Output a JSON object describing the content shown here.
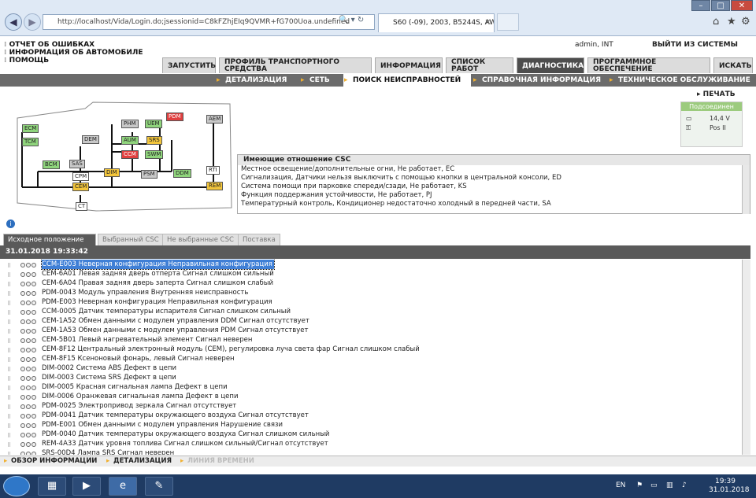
{
  "browser": {
    "url": "http://localhost/Vida/Login.do;jsessionid=C8kFZhjEIq9QVMR+fG700Uoa.undefined",
    "tab_title": "S60 (-09), 2003, B5244S, AW...",
    "window_controls": [
      "–",
      "□",
      "✕"
    ]
  },
  "header": {
    "links": [
      "ОТЧЕТ ОБ ОШИБКАХ",
      "ИНФОРМАЦИЯ ОБ АВТОМОБИЛЕ",
      "ПОМОЩЬ"
    ],
    "user": "admin, INT",
    "logout": "ВЫЙТИ ИЗ СИСТЕМЫ"
  },
  "main_tabs": [
    {
      "label": "ЗАПУСТИТЬ"
    },
    {
      "label": "ПРОФИЛЬ ТРАНСПОРТНОГО СРЕДСТВА"
    },
    {
      "label": "ИНФОРМАЦИЯ"
    },
    {
      "label": "СПИСОК РАБОТ"
    },
    {
      "label": "ДИАГНОСТИКА",
      "active": true
    },
    {
      "label": "ПРОГРАММНОЕ ОБЕСПЕЧЕНИЕ"
    },
    {
      "label": "ИСКАТЬ"
    }
  ],
  "sub_tabs": [
    {
      "label": "ДЕТАЛИЗАЦИЯ"
    },
    {
      "label": "СЕТЬ"
    },
    {
      "label": "ПОИСК НЕИСПРАВНОСТЕЙ",
      "active": true
    },
    {
      "label": "СПРАВОЧНАЯ ИНФОРМАЦИЯ"
    },
    {
      "label": "ТЕХНИЧЕСКОЕ ОБСЛУЖИВАНИЕ"
    }
  ],
  "print_label": "ПЕЧАТЬ",
  "status": {
    "title": "Подсоединен",
    "voltage": "14,4 V",
    "key_position": "Pos II"
  },
  "network_nodes": [
    {
      "name": "ECM",
      "state": "green"
    },
    {
      "name": "TCM",
      "state": "green"
    },
    {
      "name": "DEM",
      "state": "grey"
    },
    {
      "name": "BCM",
      "state": "green"
    },
    {
      "name": "SAS",
      "state": "grey"
    },
    {
      "name": "CPM",
      "state": "white"
    },
    {
      "name": "CEM",
      "state": "yellow"
    },
    {
      "name": "CT",
      "state": "white"
    },
    {
      "name": "PHM",
      "state": "grey"
    },
    {
      "name": "AUM",
      "state": "green"
    },
    {
      "name": "CCM",
      "state": "red"
    },
    {
      "name": "DIM",
      "state": "yellow"
    },
    {
      "name": "UEM",
      "state": "green"
    },
    {
      "name": "SRS",
      "state": "yellow"
    },
    {
      "name": "SWM",
      "state": "green"
    },
    {
      "name": "PSM",
      "state": "grey"
    },
    {
      "name": "PDM",
      "state": "red"
    },
    {
      "name": "DDM",
      "state": "green"
    },
    {
      "name": "AEM",
      "state": "grey"
    },
    {
      "name": "RTI",
      "state": "white"
    },
    {
      "name": "REM",
      "state": "yellow"
    }
  ],
  "csc": {
    "title": "Имеющие отношение CSC",
    "items": [
      "Местное освещение/дополнительные огни, Не работает, EC",
      "Сигнализация, Датчики нельзя выключить с помощью кнопки в центральной консоли, ED",
      "Система помощи при парковке спереди/сзади, Не работает, KS",
      "Функция поддержания устойчивости, Не работает, PJ",
      "Температурный контроль, Кондиционер недостаточно холодный в передней части, SA"
    ]
  },
  "fault_tabs": [
    {
      "label": "Исходное положение",
      "active": true
    },
    {
      "label": "Выбранный CSC"
    },
    {
      "label": "Не выбранные CSC"
    },
    {
      "label": "Поставка"
    }
  ],
  "datetime": "31.01.2018 19:33:42",
  "faults": [
    "CCM-E003 Неверная конфигурация Неправильная конфигурация",
    "CEM-6A01 Левая задняя дверь отперта Сигнал слишком сильный",
    "CEM-6A04 Правая задняя дверь заперта Сигнал слишком слабый",
    "PDM-0043 Модуль управления Внутренняя неисправность",
    "PDM-E003 Неверная конфигурация Неправильная конфигурация",
    "CCM-0005 Датчик температуры испарителя Сигнал слишком сильный",
    "CEM-1A52 Обмен данными с модулем управления DDM Сигнал отсутствует",
    "CEM-1A53 Обмен данными с модулем управления PDM Сигнал отсутствует",
    "CEM-5B01 Левый нагревательный элемент Сигнал неверен",
    "CEM-8F12 Центральный электронный модуль (CEM), регулировка луча света фар Сигнал слишком слабый",
    "CEM-8F15 Ксеноновый фонарь, левый Сигнал неверен",
    "DIM-0002 Система ABS Дефект в цепи",
    "DIM-0003 Система SRS Дефект в цепи",
    "DIM-0005 Красная сигнальная лампа Дефект в цепи",
    "DIM-0006 Оранжевая сигнальная лампа Дефект в цепи",
    "PDM-0025 Электропривод зеркала Сигнал отсутствует",
    "PDM-0041 Датчик температуры окружающего воздуха Сигнал отсутствует",
    "PDM-E001 Обмен данными с модулем управления Нарушение связи",
    "PDM-0040 Датчик температуры окружающего воздуха Сигнал слишком сильный",
    "REM-4A33 Датчик уровня топлива Сигнал слишком сильный/Сигнал отсутствует",
    "SRS-00D4 Лампа SRS Сигнал неверен"
  ],
  "bottom_tabs": [
    {
      "label": "ОБЗОР ИНФОРМАЦИИ"
    },
    {
      "label": "ДЕТАЛИЗАЦИЯ"
    },
    {
      "label": "ЛИНИЯ ВРЕМЕНИ",
      "disabled": true
    }
  ],
  "taskbar": {
    "lang": "EN",
    "time": "19:39",
    "date": "31.01.2018"
  }
}
